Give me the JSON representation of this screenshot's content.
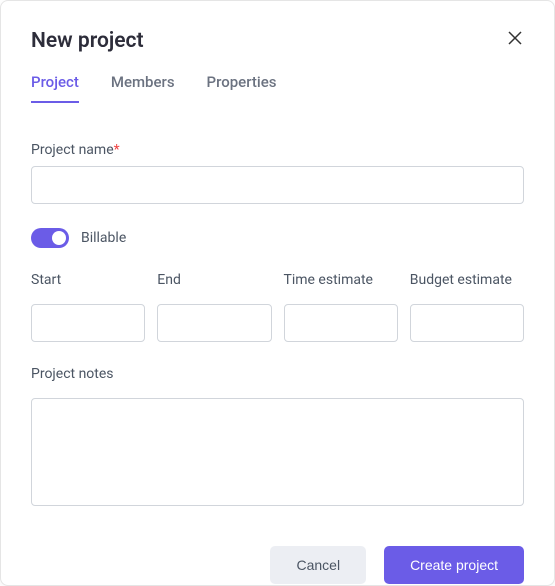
{
  "modal": {
    "title": "New project"
  },
  "tabs": {
    "project": "Project",
    "members": "Members",
    "properties": "Properties"
  },
  "form": {
    "project_name_label": "Project name",
    "project_name_value": "",
    "billable_label": "Billable",
    "billable_on": true,
    "start_label": "Start",
    "start_value": "",
    "end_label": "End",
    "end_value": "",
    "time_estimate_label": "Time estimate",
    "time_estimate_value": "",
    "budget_estimate_label": "Budget estimate",
    "budget_estimate_value": "",
    "notes_label": "Project notes",
    "notes_value": ""
  },
  "footer": {
    "cancel_label": "Cancel",
    "create_label": "Create project"
  }
}
